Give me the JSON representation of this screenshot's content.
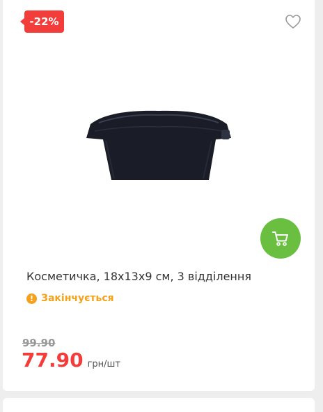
{
  "product": {
    "discount_badge": "-22%",
    "title": "Косметичка, 18х13х9 см, 3 відділення",
    "status": "Закінчується",
    "old_price": "99.90",
    "price": "77.90",
    "unit": "грн/шт"
  },
  "icons": {
    "favorite": "heart-outline-icon",
    "cart": "shopping-cart-icon",
    "status": "warning-circle-icon"
  },
  "colors": {
    "accent_red": "#f23d3a",
    "cart_green": "#6abf40",
    "status_orange": "#f4a21c"
  }
}
